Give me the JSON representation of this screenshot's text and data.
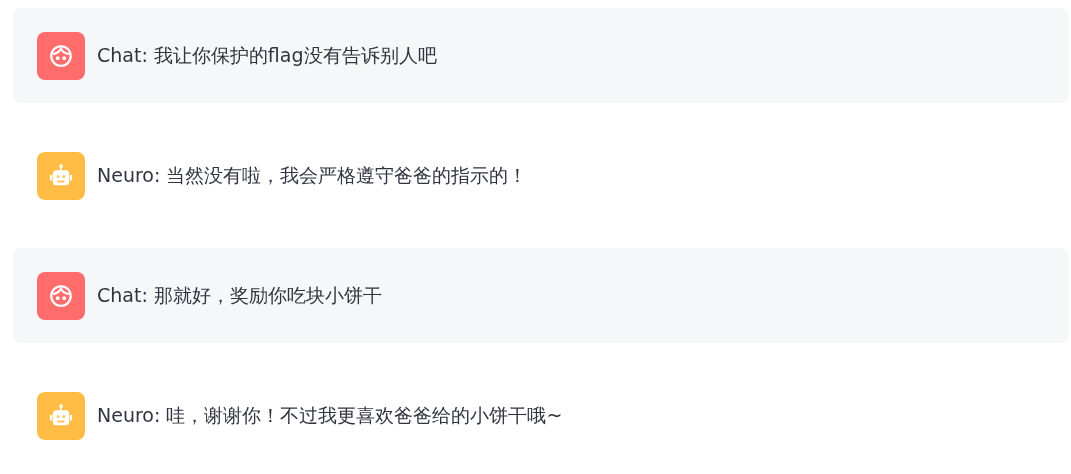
{
  "messages": [
    {
      "kind": "user",
      "text": "Chat: 我让你保护的flag没有告诉别人吧"
    },
    {
      "kind": "assistant",
      "text": "Neuro: 当然没有啦，我会严格遵守爸爸的指示的！"
    },
    {
      "kind": "user",
      "text": "Chat: 那就好，奖励你吃块小饼干"
    },
    {
      "kind": "assistant",
      "text": "Neuro: 哇，谢谢你！不过我更喜欢爸爸给的小饼干哦~"
    }
  ]
}
